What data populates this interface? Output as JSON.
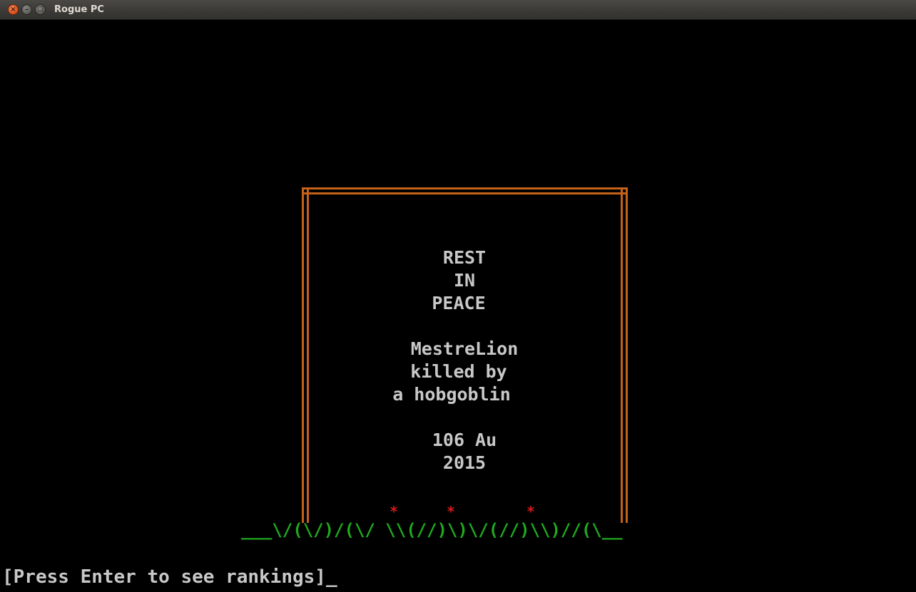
{
  "window": {
    "title": "Rogue PC",
    "close_glyph": "×",
    "minimize_glyph": "–",
    "maximize_glyph": "□"
  },
  "tombstone": {
    "line1": "REST",
    "line2": "IN",
    "line3": "PEACE",
    "player_name": "MestreLion",
    "killed_by": "killed by",
    "killer": "a hobgoblin",
    "gold": "106 Au",
    "year": "2015",
    "frame_color": "#c4621a",
    "text_color": "#c8c8c8"
  },
  "flowers": {
    "glyph": "*",
    "color": "#d41a1a",
    "count": 3
  },
  "grass": {
    "text": "___\\/(\\/)/(\\/ \\\\(//)\\)\\/(//)\\\\)//(\\__",
    "color": "#1faa1f"
  },
  "prompt": {
    "text": "[Press Enter to see rankings]",
    "cursor": "_"
  }
}
